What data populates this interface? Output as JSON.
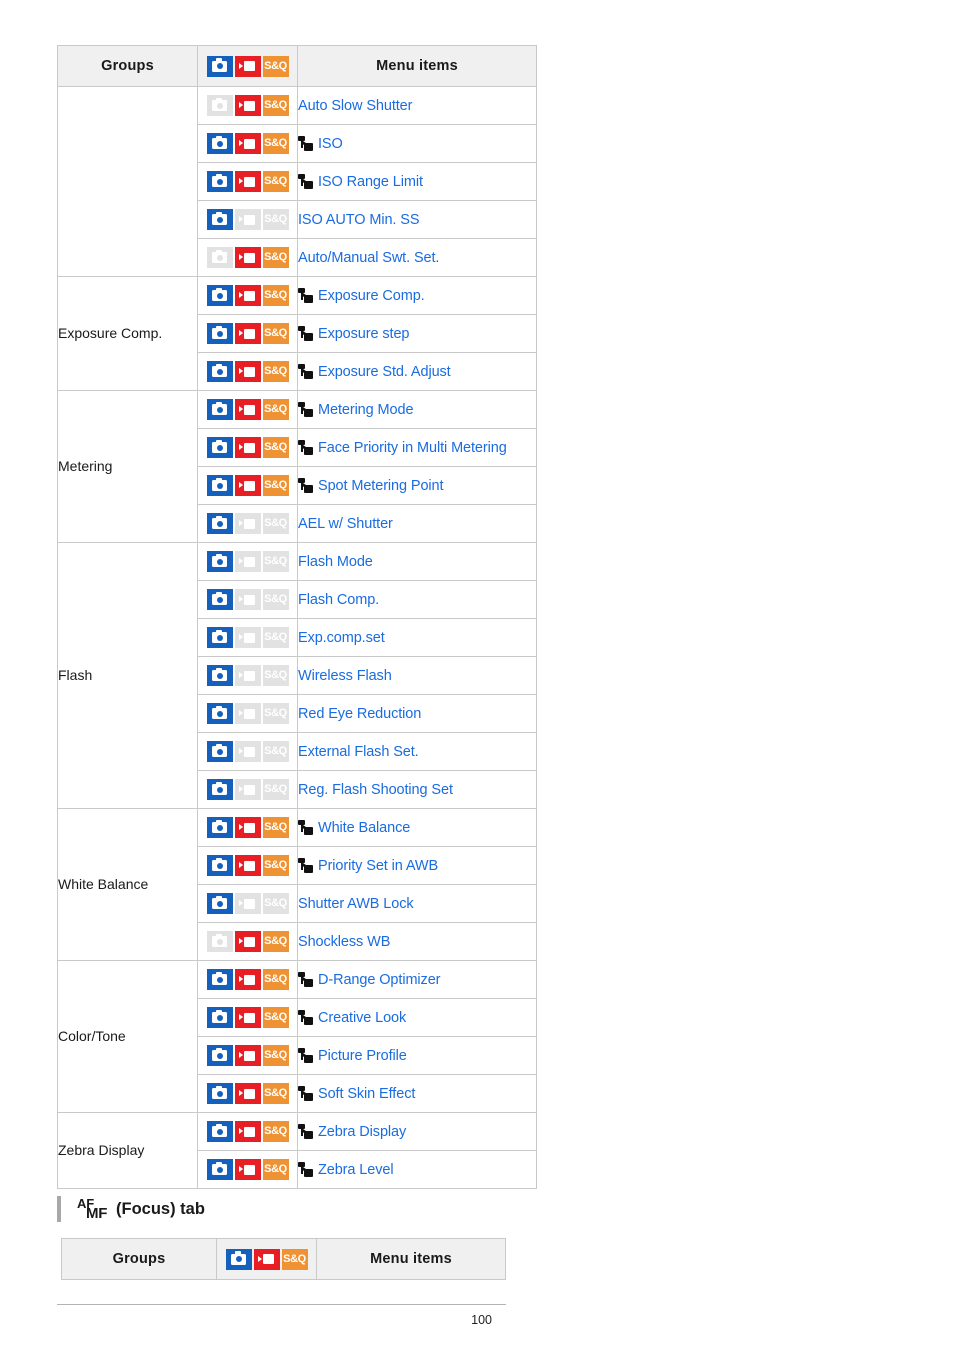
{
  "document": {
    "page_number": "100"
  },
  "main_table": {
    "headers": {
      "groups": "Groups",
      "icons": "camera-movie-sandq-icons",
      "menu_items": "Menu items"
    },
    "groups": [
      {
        "label": "",
        "rows": [
          {
            "icons": {
              "camera": false,
              "movie": true,
              "sandq": true
            },
            "mr": false,
            "label": "Auto Slow Shutter"
          },
          {
            "icons": {
              "camera": true,
              "movie": true,
              "sandq": true
            },
            "mr": true,
            "label": "ISO"
          },
          {
            "icons": {
              "camera": true,
              "movie": true,
              "sandq": true
            },
            "mr": true,
            "label": "ISO Range Limit"
          },
          {
            "icons": {
              "camera": true,
              "movie": false,
              "sandq": false
            },
            "mr": false,
            "label": "ISO AUTO Min. SS"
          },
          {
            "icons": {
              "camera": false,
              "movie": true,
              "sandq": true
            },
            "mr": false,
            "label": "Auto/Manual Swt. Set."
          }
        ]
      },
      {
        "label": "Exposure Comp.",
        "rows": [
          {
            "icons": {
              "camera": true,
              "movie": true,
              "sandq": true
            },
            "mr": true,
            "label": "Exposure Comp."
          },
          {
            "icons": {
              "camera": true,
              "movie": true,
              "sandq": true
            },
            "mr": true,
            "label": "Exposure step"
          },
          {
            "icons": {
              "camera": true,
              "movie": true,
              "sandq": true
            },
            "mr": true,
            "label": "Exposure Std. Adjust"
          }
        ]
      },
      {
        "label": "Metering",
        "rows": [
          {
            "icons": {
              "camera": true,
              "movie": true,
              "sandq": true
            },
            "mr": true,
            "label": "Metering Mode"
          },
          {
            "icons": {
              "camera": true,
              "movie": true,
              "sandq": true
            },
            "mr": true,
            "label": "Face Priority in Multi Metering"
          },
          {
            "icons": {
              "camera": true,
              "movie": true,
              "sandq": true
            },
            "mr": true,
            "label": "Spot Metering Point"
          },
          {
            "icons": {
              "camera": true,
              "movie": false,
              "sandq": false
            },
            "mr": false,
            "label": "AEL w/ Shutter"
          }
        ]
      },
      {
        "label": "Flash",
        "rows": [
          {
            "icons": {
              "camera": true,
              "movie": false,
              "sandq": false
            },
            "mr": false,
            "label": "Flash Mode"
          },
          {
            "icons": {
              "camera": true,
              "movie": false,
              "sandq": false
            },
            "mr": false,
            "label": "Flash Comp."
          },
          {
            "icons": {
              "camera": true,
              "movie": false,
              "sandq": false
            },
            "mr": false,
            "label": "Exp.comp.set"
          },
          {
            "icons": {
              "camera": true,
              "movie": false,
              "sandq": false
            },
            "mr": false,
            "label": "Wireless Flash"
          },
          {
            "icons": {
              "camera": true,
              "movie": false,
              "sandq": false
            },
            "mr": false,
            "label": "Red Eye Reduction"
          },
          {
            "icons": {
              "camera": true,
              "movie": false,
              "sandq": false
            },
            "mr": false,
            "label": "External Flash Set."
          },
          {
            "icons": {
              "camera": true,
              "movie": false,
              "sandq": false
            },
            "mr": false,
            "label": "Reg. Flash Shooting Set"
          }
        ]
      },
      {
        "label": "White Balance",
        "rows": [
          {
            "icons": {
              "camera": true,
              "movie": true,
              "sandq": true
            },
            "mr": true,
            "label": "White Balance"
          },
          {
            "icons": {
              "camera": true,
              "movie": true,
              "sandq": true
            },
            "mr": true,
            "label": "Priority Set in AWB"
          },
          {
            "icons": {
              "camera": true,
              "movie": false,
              "sandq": false
            },
            "mr": false,
            "label": "Shutter AWB Lock"
          },
          {
            "icons": {
              "camera": false,
              "movie": true,
              "sandq": true
            },
            "mr": false,
            "label": "Shockless WB"
          }
        ]
      },
      {
        "label": "Color/Tone",
        "rows": [
          {
            "icons": {
              "camera": true,
              "movie": true,
              "sandq": true
            },
            "mr": true,
            "label": "D-Range Optimizer"
          },
          {
            "icons": {
              "camera": true,
              "movie": true,
              "sandq": true
            },
            "mr": true,
            "label": "Creative Look"
          },
          {
            "icons": {
              "camera": true,
              "movie": true,
              "sandq": true
            },
            "mr": true,
            "label": "Picture Profile"
          },
          {
            "icons": {
              "camera": true,
              "movie": true,
              "sandq": true
            },
            "mr": true,
            "label": "Soft Skin Effect"
          }
        ]
      },
      {
        "label": "Zebra Display",
        "rows": [
          {
            "icons": {
              "camera": true,
              "movie": true,
              "sandq": true
            },
            "mr": true,
            "label": "Zebra Display"
          },
          {
            "icons": {
              "camera": true,
              "movie": true,
              "sandq": true
            },
            "mr": true,
            "label": "Zebra Level"
          }
        ]
      }
    ]
  },
  "focus_section": {
    "heading_af": "AF",
    "heading_mf": "MF",
    "heading_text": "(Focus) tab",
    "headers": {
      "groups": "Groups",
      "icons": "camera-movie-sandq-icons",
      "menu_items": "Menu items"
    }
  },
  "icons": {
    "camera": "camera-icon",
    "movie": "movie-icon",
    "sandq": "S&Q",
    "mr": "register-icon"
  },
  "colors": {
    "camera_on": "#1560bd",
    "movie_on": "#e81e25",
    "sandq_on": "#ef9234",
    "icon_off": "#e2e2e2",
    "link": "#1a6ce0",
    "header_bg": "#f0f0f0",
    "border": "#c9c9c9"
  }
}
